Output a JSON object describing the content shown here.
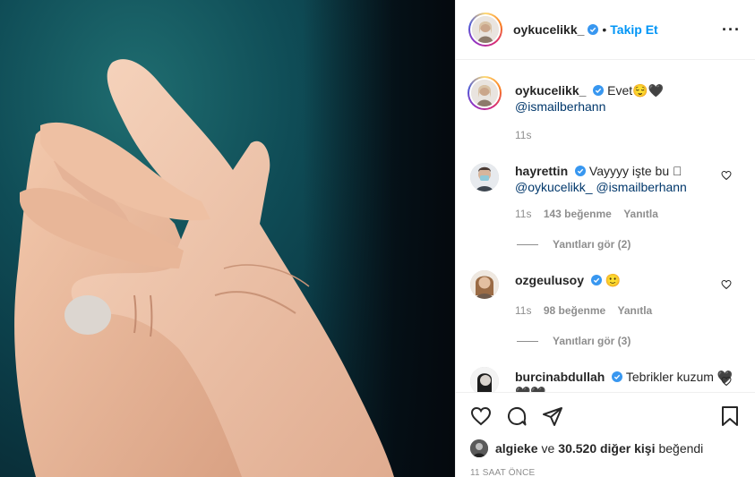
{
  "post": {
    "username": "oykucelikk_",
    "dot": "•",
    "follow_label": "Takip Et",
    "more_icon": "more-horizontal-icon",
    "caption_text": "Evet😌🖤",
    "caption_mention": "@ismailberhann",
    "caption_time": "11s"
  },
  "comments": [
    {
      "username": "hayrettin",
      "text": "Vayyyy işte bu 🏻",
      "mentions": "@oykucelikk_ @ismailberhann",
      "time": "11s",
      "likes": "143 beğenme",
      "reply": "Yanıtla",
      "view_replies": "Yanıtları gör (2)"
    },
    {
      "username": "ozgeulusoy",
      "text": "🙂",
      "time": "11s",
      "likes": "98 beğenme",
      "reply": "Yanıtla",
      "view_replies": "Yanıtları gör (3)"
    },
    {
      "username": "burcinabdullah",
      "text": "Tebrikler kuzum 🖤🖤🖤"
    }
  ],
  "likes_summary": {
    "user": "algieke",
    "connector": "ve",
    "count": "30.520 diğer kişi",
    "suffix": "beğendi"
  },
  "timestamp": "11 SAAT ÖNCE",
  "colors": {
    "accent": "#0095f6",
    "verified": "#3897f0",
    "text": "#262626",
    "muted": "#8e8e8e"
  }
}
